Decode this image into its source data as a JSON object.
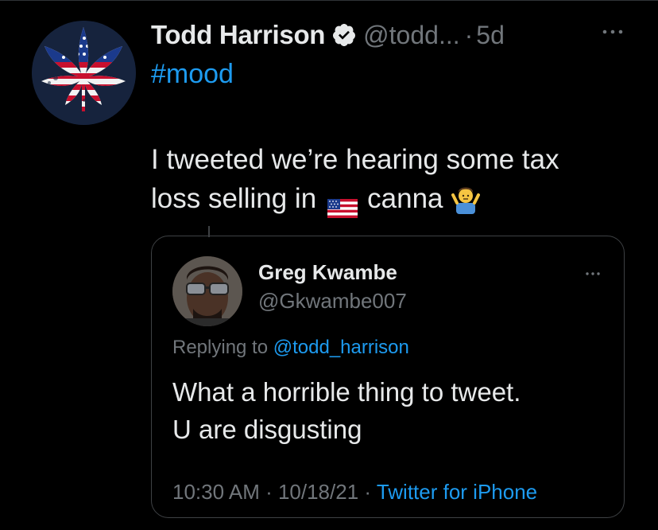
{
  "tweet": {
    "author_name": "Todd Harrison",
    "author_handle": "@todd...",
    "separator": "·",
    "time_ago": "5d",
    "hashtag": "#mood",
    "text_line1": "I tweeted we’re hearing some tax",
    "text_line2_before": "loss selling in",
    "text_line2_after": "canna"
  },
  "quoted_tweet": {
    "author_name": "Greg Kwambe",
    "author_handle": "@Gkwambe007",
    "replying_prefix": "Replying to",
    "replying_to": "@todd_harrison",
    "text_line1": "What a horrible thing to tweet.",
    "text_line2": "U are disgusting",
    "timestamp": "10:30 AM · 10/18/21 · ",
    "source": "Twitter for iPhone"
  },
  "icons": {
    "avatar": "cannabis-leaf-us-flag-avatar",
    "verified": "verified-badge-icon",
    "more": "more-horizontal-icon",
    "flag": "us-flag-emoji",
    "shrug": "person-shrugging-emoji"
  },
  "colors": {
    "background": "#000000",
    "text": "#e7e9ea",
    "secondary": "#71767b",
    "link": "#1d9bf0",
    "border": "#3e4144"
  }
}
